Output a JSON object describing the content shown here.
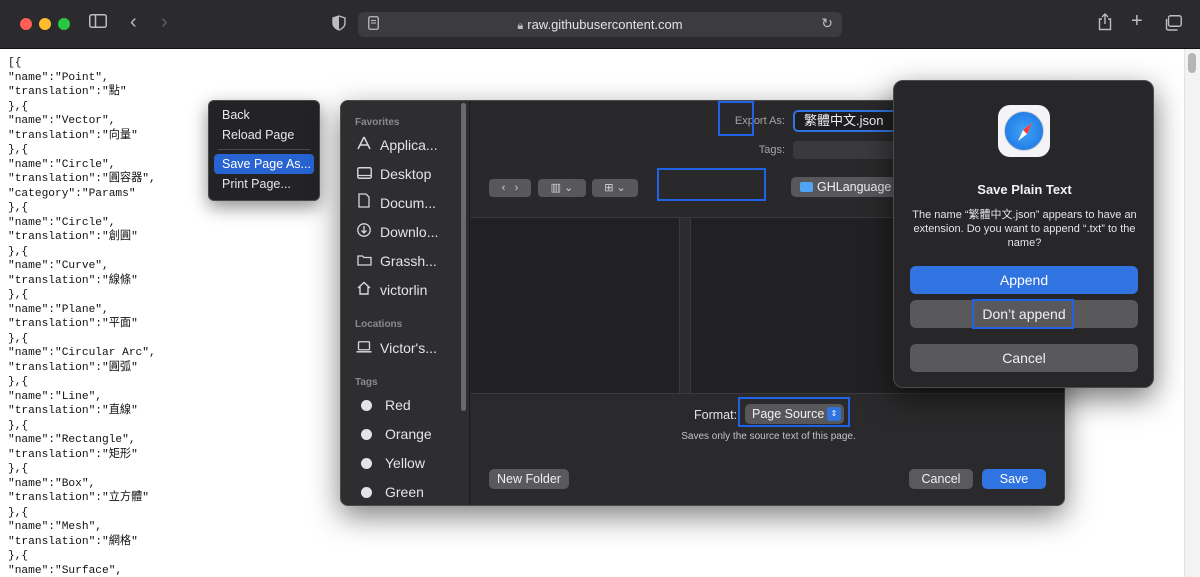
{
  "browser": {
    "url": "raw.githubusercontent.com",
    "icons": {
      "sidebar": "sidebar-icon",
      "back": "chevron-left-icon",
      "forward": "chevron-right-icon",
      "privacy": "shield-icon",
      "reader": "reader-icon",
      "lock": "lock-icon",
      "reload": "reload-icon",
      "share": "share-icon",
      "new_tab": "plus-icon",
      "tabs": "tab-overview-icon"
    }
  },
  "page_source_lines": [
    "[{",
    "\"name\":\"Point\",",
    "\"translation\":\"點\"",
    "},{",
    "\"name\":\"Vector\",",
    "\"translation\":\"向量\"",
    "},{",
    "\"name\":\"Circle\",",
    "\"translation\":\"圓容器\",",
    "\"category\":\"Params\"",
    "},{",
    "\"name\":\"Circle\",",
    "\"translation\":\"創圓\"",
    "},{",
    "\"name\":\"Curve\",",
    "\"translation\":\"線條\"",
    "},{",
    "\"name\":\"Plane\",",
    "\"translation\":\"平面\"",
    "},{",
    "\"name\":\"Circular Arc\",",
    "\"translation\":\"圓弧\"",
    "},{",
    "\"name\":\"Line\",",
    "\"translation\":\"直線\"",
    "},{",
    "\"name\":\"Rectangle\",",
    "\"translation\":\"矩形\"",
    "},{",
    "\"name\":\"Box\",",
    "\"translation\":\"立方體\"",
    "},{",
    "\"name\":\"Mesh\",",
    "\"translation\":\"網格\"",
    "},{",
    "\"name\":\"Surface\","
  ],
  "context_menu": {
    "back": "Back",
    "reload": "Reload Page",
    "save_as": "Save Page As...",
    "print": "Print Page..."
  },
  "save_dialog": {
    "sidebar": {
      "favorites_header": "Favorites",
      "favorites": [
        "Applica...",
        "Desktop",
        "Docum...",
        "Downlo...",
        "Grassh...",
        "victorlin"
      ],
      "locations_header": "Locations",
      "locations": [
        "Victor's..."
      ],
      "tags_header": "Tags",
      "tags": [
        "Red",
        "Orange",
        "Yellow",
        "Green"
      ]
    },
    "export_as_label": "Export As:",
    "filename": "繁體中文.json",
    "tags_label": "Tags:",
    "location": "GHLanguage",
    "format_label": "Format:",
    "format_value": "Page Source",
    "format_description": "Saves only the source text of this page.",
    "new_folder": "New Folder",
    "cancel": "Cancel",
    "save": "Save"
  },
  "alert": {
    "title": "Save Plain Text",
    "message": "The name “繁體中文.json” appears to have an extension. Do you want to append “.txt” to the name?",
    "append": "Append",
    "dont_append": "Don’t append",
    "cancel": "Cancel"
  },
  "colors": {
    "accent": "#2f74e0",
    "highlight": "#1f64e6",
    "dialog_bg": "#262628"
  }
}
